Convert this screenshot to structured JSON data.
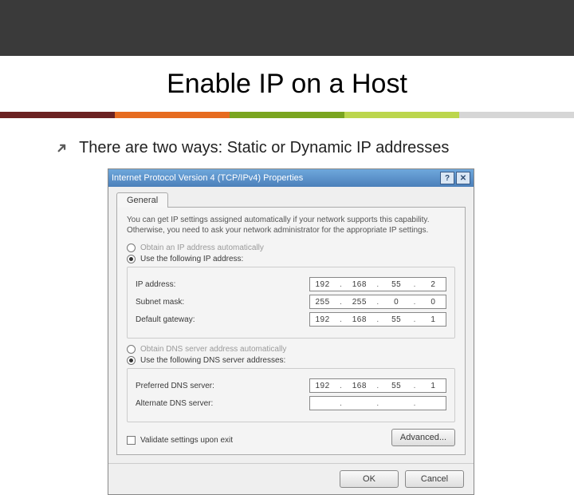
{
  "slide": {
    "title": "Enable IP on a Host",
    "bullet": "There are two ways: Static or Dynamic IP addresses"
  },
  "dialog": {
    "title": "Internet Protocol Version 4 (TCP/IPv4) Properties",
    "tab": "General",
    "description": "You can get IP settings assigned automatically if your network supports this capability. Otherwise, you need to ask your network administrator for the appropriate IP settings.",
    "radio_auto_ip": "Obtain an IP address automatically",
    "radio_static_ip": "Use the following IP address:",
    "ip_label": "IP address:",
    "ip_value": [
      "192",
      "168",
      "55",
      "2"
    ],
    "mask_label": "Subnet mask:",
    "mask_value": [
      "255",
      "255",
      "0",
      "0"
    ],
    "gw_label": "Default gateway:",
    "gw_value": [
      "192",
      "168",
      "55",
      "1"
    ],
    "radio_auto_dns": "Obtain DNS server address automatically",
    "radio_static_dns": "Use the following DNS server addresses:",
    "dns1_label": "Preferred DNS server:",
    "dns1_value": [
      "192",
      "168",
      "55",
      "1"
    ],
    "dns2_label": "Alternate DNS server:",
    "dns2_value": [
      "",
      "",
      "",
      ""
    ],
    "validate": "Validate settings upon exit",
    "advanced": "Advanced...",
    "ok": "OK",
    "cancel": "Cancel"
  }
}
